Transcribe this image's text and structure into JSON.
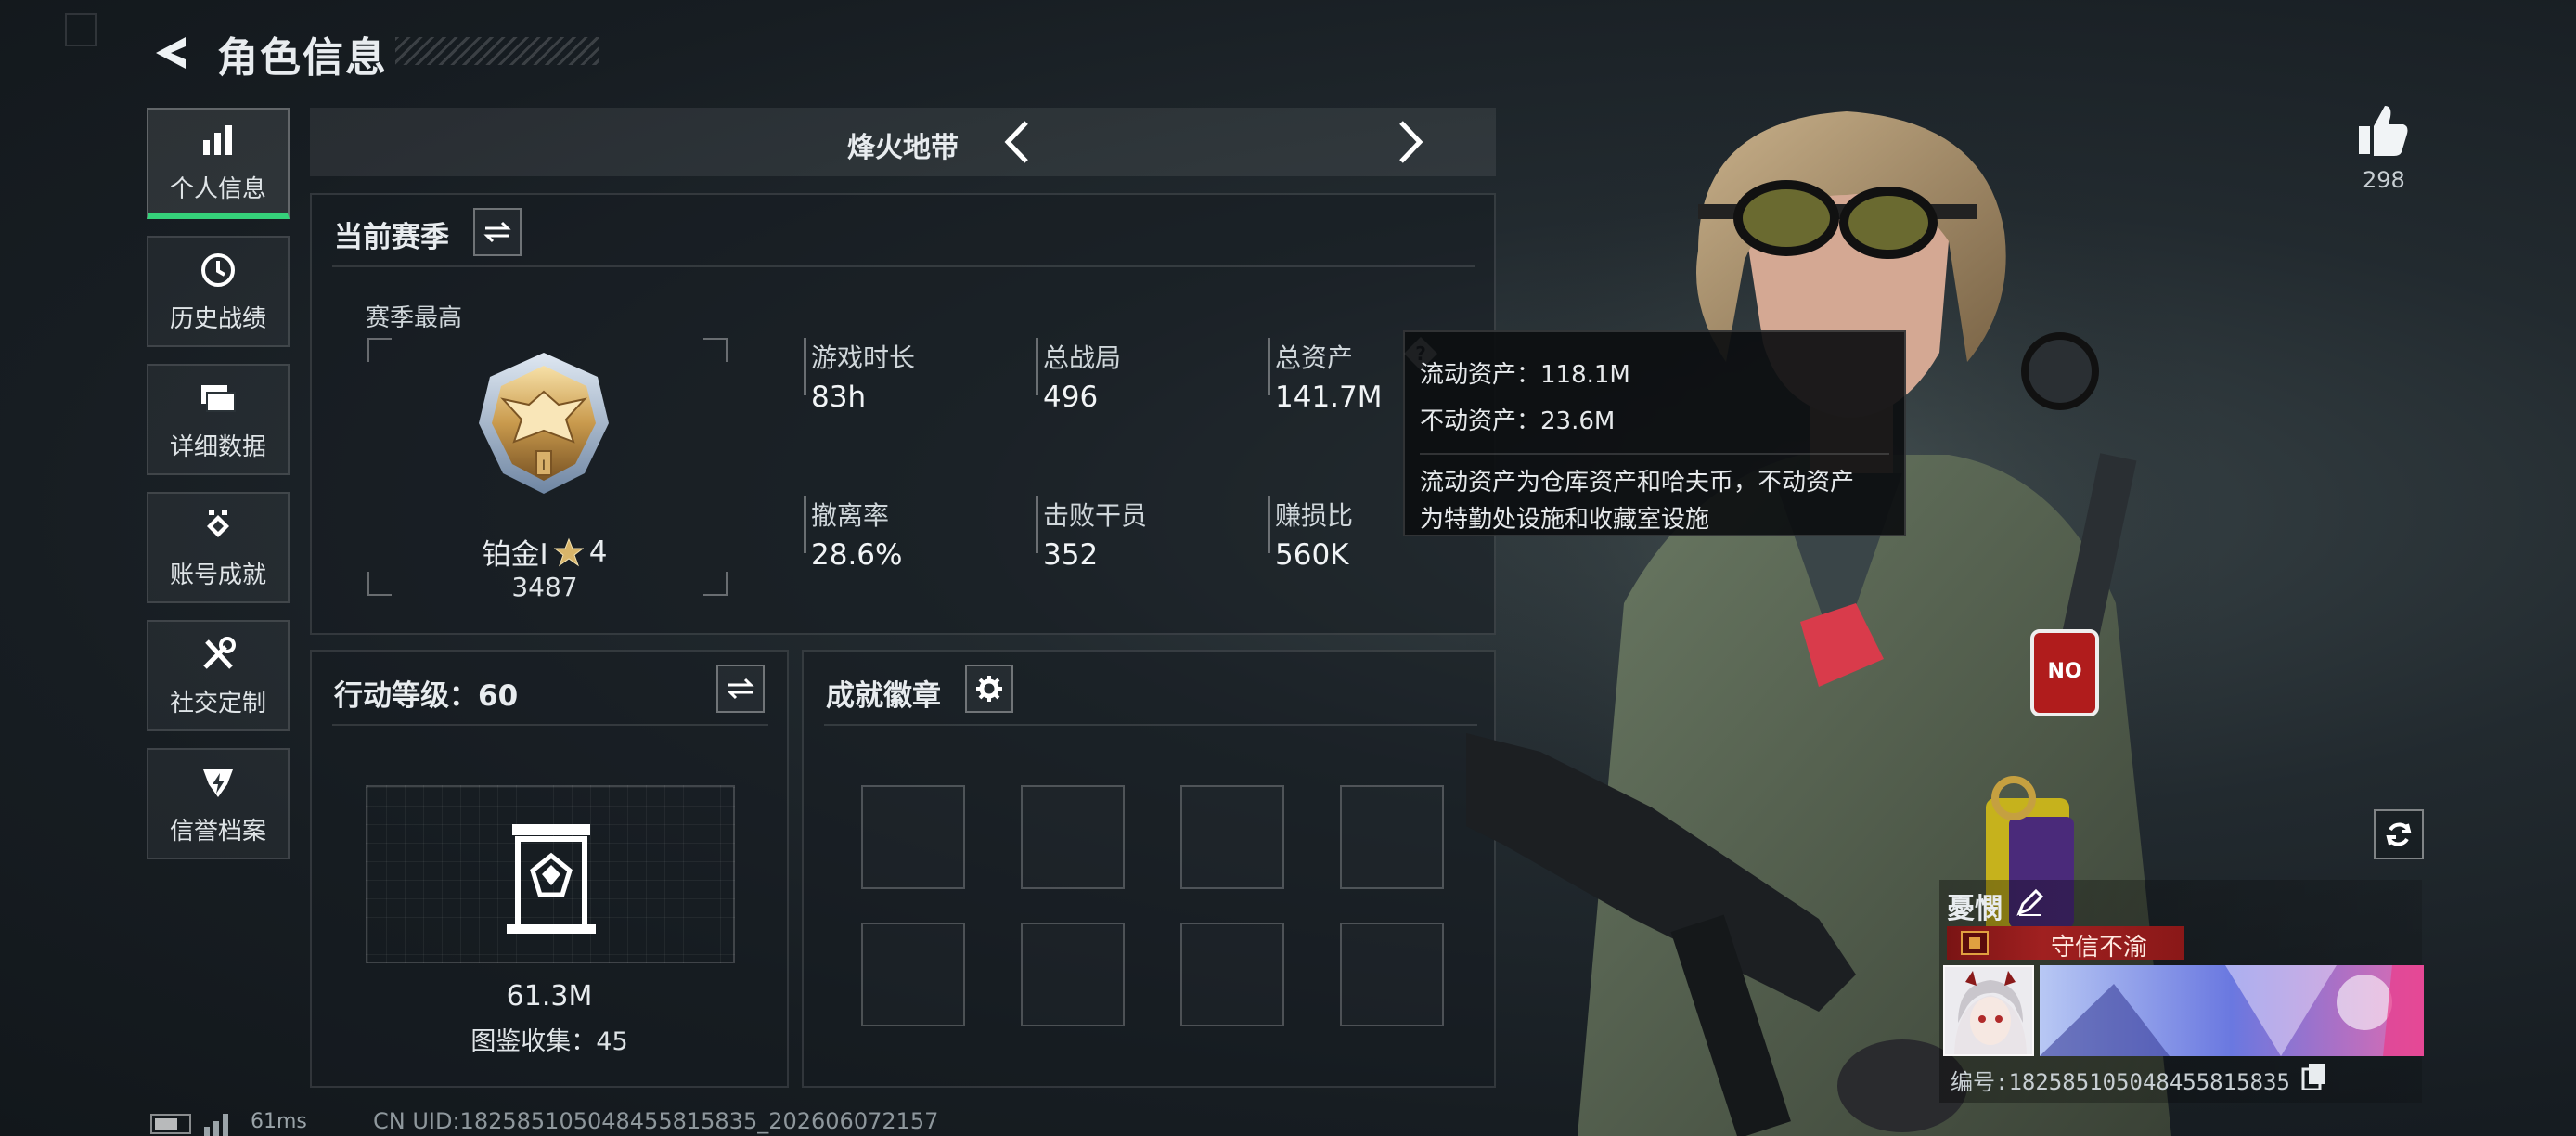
{
  "header": {
    "title": "角色信息",
    "back_icon": "back-arrow-icon"
  },
  "sidebar": {
    "items": [
      {
        "label": "个人信息",
        "icon": "bar-chart-icon",
        "active": true
      },
      {
        "label": "历史战绩",
        "icon": "history-clock-icon",
        "active": false
      },
      {
        "label": "详细数据",
        "icon": "folder-stack-icon",
        "active": false
      },
      {
        "label": "账号成就",
        "icon": "achievement-icon",
        "active": false
      },
      {
        "label": "社交定制",
        "icon": "tools-icon",
        "active": false
      },
      {
        "label": "信誉档案",
        "icon": "credit-shield-icon",
        "active": false
      }
    ],
    "accent_color": "#35d17a"
  },
  "mode_selector": {
    "label": "烽火地带"
  },
  "season": {
    "title": "当前赛季",
    "best_label": "赛季最高",
    "rank_name": "铂金Ⅰ",
    "rank_stars": "4",
    "rank_score": "3487",
    "stats": [
      {
        "label": "游戏时长",
        "value": "83h"
      },
      {
        "label": "总战局",
        "value": "496"
      },
      {
        "label": "总资产",
        "value": "141.7M"
      },
      {
        "label": "撤离率",
        "value": "28.6%"
      },
      {
        "label": "击败干员",
        "value": "352"
      },
      {
        "label": "赚损比",
        "value": "560K"
      }
    ]
  },
  "tooltip": {
    "line1": "流动资产：118.1M",
    "line2": "不动资产：23.6M",
    "desc_line1": "流动资产为仓库资产和哈夫币，不动资产",
    "desc_line2": "为特勤处设施和收藏室设施"
  },
  "action_level": {
    "title": "行动等级：60",
    "collection_value": "61.3M",
    "collection_label": "图鉴收集：45"
  },
  "badges": {
    "title": "成就徽章",
    "slots": 8
  },
  "likes": {
    "count": "298"
  },
  "player": {
    "name": "憂憫",
    "title": "守信不渝",
    "id_line": "编号:1825851050484558​15835"
  },
  "footer": {
    "ping": "61ms",
    "uid_line": "CN UID:1825851050484558​15835_202606072157"
  }
}
